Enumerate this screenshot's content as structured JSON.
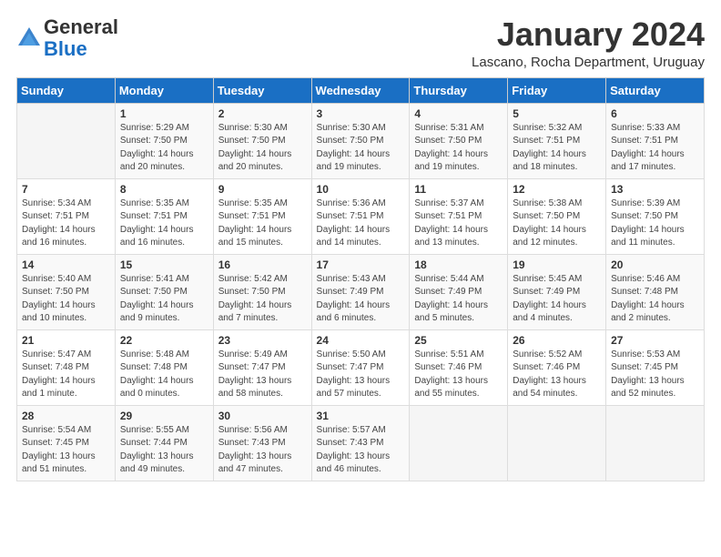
{
  "header": {
    "logo_general": "General",
    "logo_blue": "Blue",
    "month_title": "January 2024",
    "subtitle": "Lascano, Rocha Department, Uruguay"
  },
  "days_of_week": [
    "Sunday",
    "Monday",
    "Tuesday",
    "Wednesday",
    "Thursday",
    "Friday",
    "Saturday"
  ],
  "weeks": [
    [
      {
        "day": "",
        "content": ""
      },
      {
        "day": "1",
        "content": "Sunrise: 5:29 AM\nSunset: 7:50 PM\nDaylight: 14 hours\nand 20 minutes."
      },
      {
        "day": "2",
        "content": "Sunrise: 5:30 AM\nSunset: 7:50 PM\nDaylight: 14 hours\nand 20 minutes."
      },
      {
        "day": "3",
        "content": "Sunrise: 5:30 AM\nSunset: 7:50 PM\nDaylight: 14 hours\nand 19 minutes."
      },
      {
        "day": "4",
        "content": "Sunrise: 5:31 AM\nSunset: 7:50 PM\nDaylight: 14 hours\nand 19 minutes."
      },
      {
        "day": "5",
        "content": "Sunrise: 5:32 AM\nSunset: 7:51 PM\nDaylight: 14 hours\nand 18 minutes."
      },
      {
        "day": "6",
        "content": "Sunrise: 5:33 AM\nSunset: 7:51 PM\nDaylight: 14 hours\nand 17 minutes."
      }
    ],
    [
      {
        "day": "7",
        "content": "Sunrise: 5:34 AM\nSunset: 7:51 PM\nDaylight: 14 hours\nand 16 minutes."
      },
      {
        "day": "8",
        "content": "Sunrise: 5:35 AM\nSunset: 7:51 PM\nDaylight: 14 hours\nand 16 minutes."
      },
      {
        "day": "9",
        "content": "Sunrise: 5:35 AM\nSunset: 7:51 PM\nDaylight: 14 hours\nand 15 minutes."
      },
      {
        "day": "10",
        "content": "Sunrise: 5:36 AM\nSunset: 7:51 PM\nDaylight: 14 hours\nand 14 minutes."
      },
      {
        "day": "11",
        "content": "Sunrise: 5:37 AM\nSunset: 7:51 PM\nDaylight: 14 hours\nand 13 minutes."
      },
      {
        "day": "12",
        "content": "Sunrise: 5:38 AM\nSunset: 7:50 PM\nDaylight: 14 hours\nand 12 minutes."
      },
      {
        "day": "13",
        "content": "Sunrise: 5:39 AM\nSunset: 7:50 PM\nDaylight: 14 hours\nand 11 minutes."
      }
    ],
    [
      {
        "day": "14",
        "content": "Sunrise: 5:40 AM\nSunset: 7:50 PM\nDaylight: 14 hours\nand 10 minutes."
      },
      {
        "day": "15",
        "content": "Sunrise: 5:41 AM\nSunset: 7:50 PM\nDaylight: 14 hours\nand 9 minutes."
      },
      {
        "day": "16",
        "content": "Sunrise: 5:42 AM\nSunset: 7:50 PM\nDaylight: 14 hours\nand 7 minutes."
      },
      {
        "day": "17",
        "content": "Sunrise: 5:43 AM\nSunset: 7:49 PM\nDaylight: 14 hours\nand 6 minutes."
      },
      {
        "day": "18",
        "content": "Sunrise: 5:44 AM\nSunset: 7:49 PM\nDaylight: 14 hours\nand 5 minutes."
      },
      {
        "day": "19",
        "content": "Sunrise: 5:45 AM\nSunset: 7:49 PM\nDaylight: 14 hours\nand 4 minutes."
      },
      {
        "day": "20",
        "content": "Sunrise: 5:46 AM\nSunset: 7:48 PM\nDaylight: 14 hours\nand 2 minutes."
      }
    ],
    [
      {
        "day": "21",
        "content": "Sunrise: 5:47 AM\nSunset: 7:48 PM\nDaylight: 14 hours\nand 1 minute."
      },
      {
        "day": "22",
        "content": "Sunrise: 5:48 AM\nSunset: 7:48 PM\nDaylight: 14 hours\nand 0 minutes."
      },
      {
        "day": "23",
        "content": "Sunrise: 5:49 AM\nSunset: 7:47 PM\nDaylight: 13 hours\nand 58 minutes."
      },
      {
        "day": "24",
        "content": "Sunrise: 5:50 AM\nSunset: 7:47 PM\nDaylight: 13 hours\nand 57 minutes."
      },
      {
        "day": "25",
        "content": "Sunrise: 5:51 AM\nSunset: 7:46 PM\nDaylight: 13 hours\nand 55 minutes."
      },
      {
        "day": "26",
        "content": "Sunrise: 5:52 AM\nSunset: 7:46 PM\nDaylight: 13 hours\nand 54 minutes."
      },
      {
        "day": "27",
        "content": "Sunrise: 5:53 AM\nSunset: 7:45 PM\nDaylight: 13 hours\nand 52 minutes."
      }
    ],
    [
      {
        "day": "28",
        "content": "Sunrise: 5:54 AM\nSunset: 7:45 PM\nDaylight: 13 hours\nand 51 minutes."
      },
      {
        "day": "29",
        "content": "Sunrise: 5:55 AM\nSunset: 7:44 PM\nDaylight: 13 hours\nand 49 minutes."
      },
      {
        "day": "30",
        "content": "Sunrise: 5:56 AM\nSunset: 7:43 PM\nDaylight: 13 hours\nand 47 minutes."
      },
      {
        "day": "31",
        "content": "Sunrise: 5:57 AM\nSunset: 7:43 PM\nDaylight: 13 hours\nand 46 minutes."
      },
      {
        "day": "",
        "content": ""
      },
      {
        "day": "",
        "content": ""
      },
      {
        "day": "",
        "content": ""
      }
    ]
  ]
}
